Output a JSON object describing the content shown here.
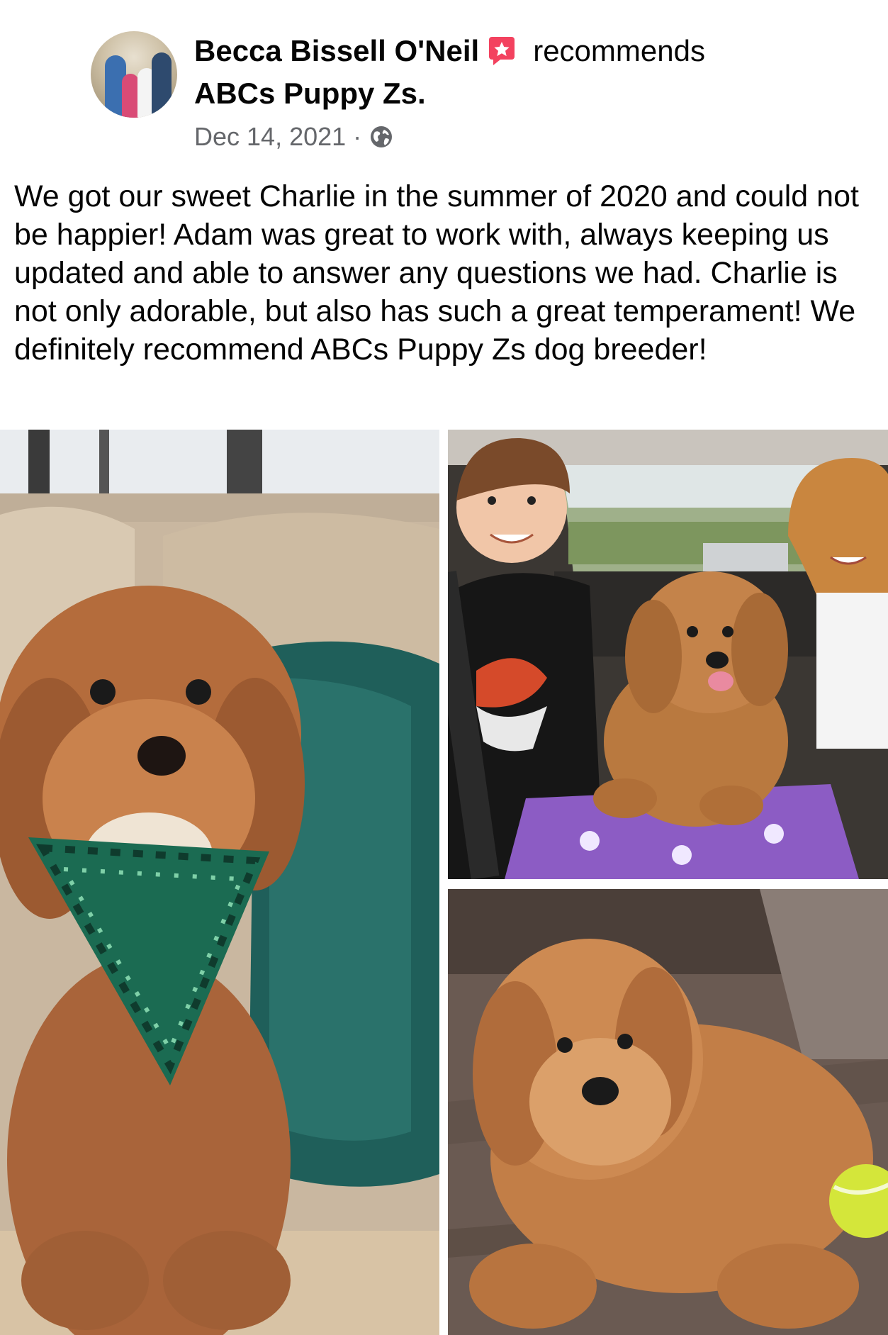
{
  "post": {
    "author_name": "Becca Bissell O'Neil",
    "action": "recommends",
    "page_name": "ABCs Puppy Zs.",
    "date": "Dec 14, 2021",
    "separator": "·",
    "privacy_icon": "globe-icon",
    "recommend_badge_icon": "star-recommend-icon",
    "body": "We got our sweet Charlie in the summer of 2020 and could not be happier! Adam was great to work with, always keeping us updated and able to answer any questions we had. Charlie is not only adorable, but also has such a great temperament! We definitely recommend ABCs Puppy Zs dog breeder!"
  },
  "photos": [
    {
      "subject": "puppy-with-green-bandana"
    },
    {
      "subject": "kids-with-puppy-in-car"
    },
    {
      "subject": "puppy-lying-with-tennis-ball"
    }
  ],
  "colors": {
    "badge": "#f3425f",
    "meta_text": "#65676b"
  }
}
